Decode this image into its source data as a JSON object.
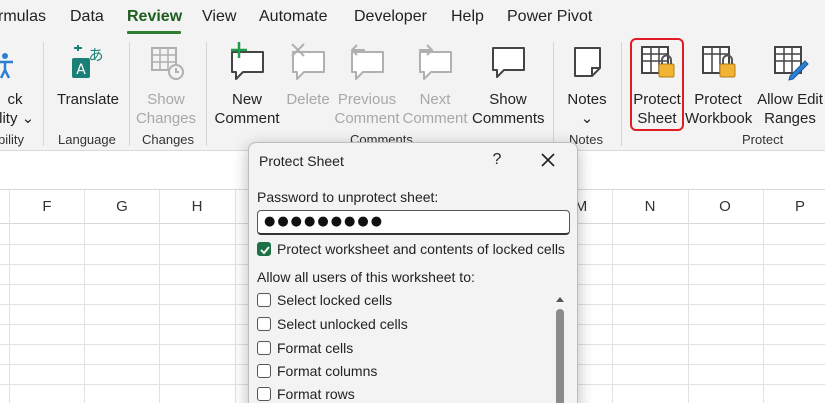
{
  "tabs": [
    {
      "label": "rmulas",
      "active": false
    },
    {
      "label": "Data",
      "active": false
    },
    {
      "label": "Review",
      "active": true
    },
    {
      "label": "View",
      "active": false
    },
    {
      "label": "Automate",
      "active": false
    },
    {
      "label": "Developer",
      "active": false
    },
    {
      "label": "Help",
      "active": false
    },
    {
      "label": "Power Pivot",
      "active": false
    }
  ],
  "ribbon": {
    "accessibility": {
      "line1": "ck",
      "line2": "ility ⌄",
      "group": "bility"
    },
    "translate": {
      "label": "Translate",
      "group": "Language"
    },
    "show_changes": {
      "line1": "Show",
      "line2": "Changes",
      "group": "Changes"
    },
    "new_comment": {
      "line1": "New",
      "line2": "Comment"
    },
    "delete": {
      "line1": "Delete"
    },
    "previous_comment": {
      "line1": "Previous",
      "line2": "Comment"
    },
    "next_comment": {
      "line1": "Next",
      "line2": "Comment"
    },
    "show_comments": {
      "line1": "Show",
      "line2": "Comments"
    },
    "comments_group": "Comments",
    "notes": {
      "line1": "Notes",
      "line2": "⌄",
      "group": "Notes"
    },
    "protect_sheet": {
      "line1": "Protect",
      "line2": "Sheet"
    },
    "protect_workbook": {
      "line1": "Protect",
      "line2": "Workbook"
    },
    "allow_edit_ranges": {
      "line1": "Allow Edit",
      "line2": "Ranges"
    },
    "protect_group": "Protect"
  },
  "columns": [
    "F",
    "G",
    "H",
    "M",
    "N",
    "O",
    "P"
  ],
  "dialog": {
    "title": "Protect Sheet",
    "help": "?",
    "password_label": "Password to unprotect sheet:",
    "password_value": "●●●●●●●●●",
    "protect_contents": {
      "label": "Protect worksheet and contents of locked cells",
      "checked": true
    },
    "allow_label": "Allow all users of this worksheet to:",
    "options": [
      {
        "label": "Select locked cells",
        "checked": false
      },
      {
        "label": "Select unlocked cells",
        "checked": false
      },
      {
        "label": "Format cells",
        "checked": false
      },
      {
        "label": "Format columns",
        "checked": false
      },
      {
        "label": "Format rows",
        "checked": false
      }
    ]
  },
  "colors": {
    "accent": "#1e7145",
    "highlight": "#e11c24",
    "ribbon_bg": "#f3f3f3"
  }
}
